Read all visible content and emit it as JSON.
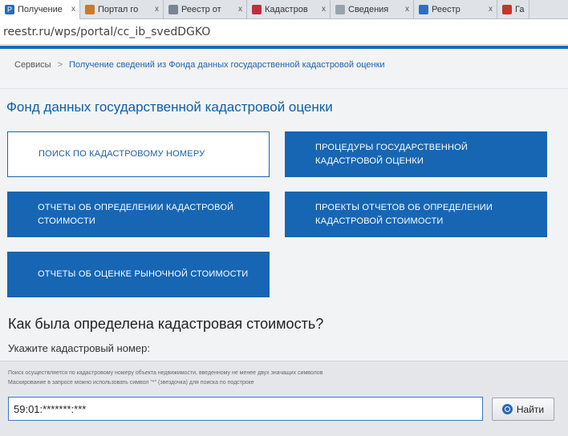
{
  "browser": {
    "tabs": [
      {
        "label": "Получение",
        "icon": "page-icon",
        "color": "#2b6cb3",
        "active": true
      },
      {
        "label": "Портал го",
        "icon": "portal-icon",
        "color": "#c97a2b",
        "active": false
      },
      {
        "label": "Реестр от",
        "icon": "registry-icon",
        "color": "#7a8593",
        "active": false
      },
      {
        "label": "Кадастров",
        "icon": "map-icon",
        "color": "#b8323a",
        "active": false
      },
      {
        "label": "Сведения",
        "icon": "document-icon",
        "color": "#9aa3ad",
        "active": false
      },
      {
        "label": "Реестр",
        "icon": "refresh-icon",
        "color": "#2f6fbf",
        "active": false
      },
      {
        "label": "Га",
        "icon": "gov-icon",
        "color": "#c0392b",
        "active": false
      }
    ],
    "close_glyph": "x",
    "url": "reestr.ru/wps/portal/cc_ib_svedDGKO"
  },
  "breadcrumb": {
    "root": "Сервисы",
    "separator": ">",
    "current": "Получение сведений из Фонда данных государственной кадастровой оценки"
  },
  "page_title": "Фонд данных государственной кадастровой оценки",
  "tiles": [
    {
      "label": "Поиск по кадастровому номеру",
      "style": "outline"
    },
    {
      "label": "Процедуры государственной кадастровой оценки",
      "style": "filled"
    },
    {
      "label": "Отчеты об определении кадастровой стоимости",
      "style": "filled"
    },
    {
      "label": "Проекты отчетов об определении кадастровой стоимости",
      "style": "filled"
    },
    {
      "label": "Отчеты об оценке рыночной стоимости",
      "style": "filled"
    }
  ],
  "question": "Как была определена кадастровая стоимость?",
  "search": {
    "label": "Укажите кадастровый номер:",
    "hint_line1": "Поиск осуществляется по кадастровому номеру объекта недвижимости, введенному не менее двух значащих символов",
    "hint_line2": "Маскирование в запросе можно использовать символ \"*\" (звездочка) для поиска по подстроке",
    "input_value": "59:01:*******:***",
    "button_label": "Найти",
    "button_icon": "search-icon"
  },
  "colors": {
    "accent": "#1666b4",
    "title": "#0e5fa8",
    "link": "#1e63b0"
  }
}
